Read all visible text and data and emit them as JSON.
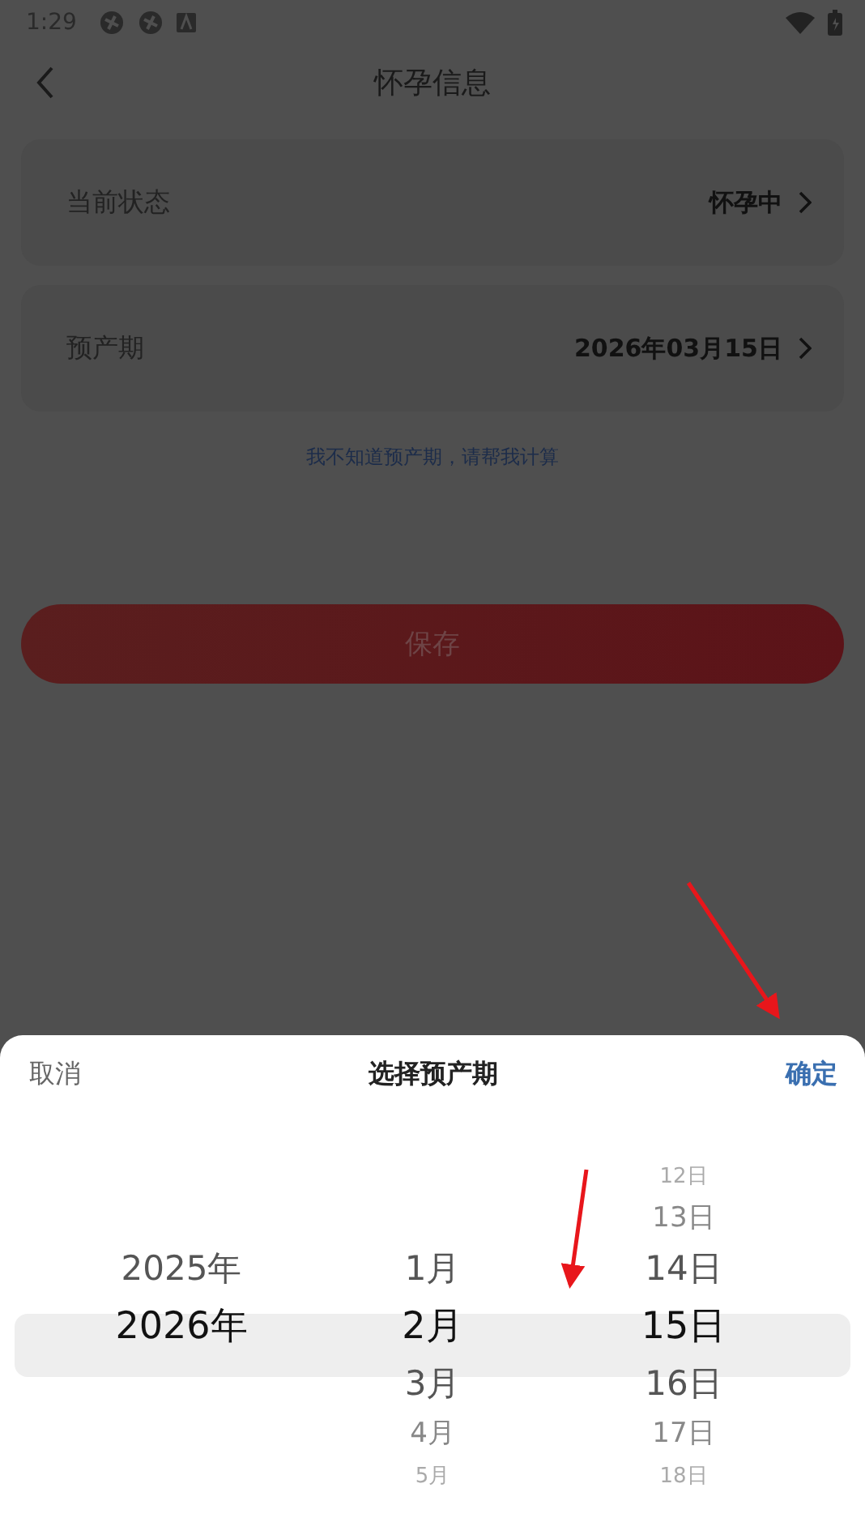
{
  "status_bar": {
    "time": "1:29"
  },
  "header": {
    "title": "怀孕信息"
  },
  "fields": [
    {
      "label": "当前状态",
      "value": "怀孕中"
    },
    {
      "label": "预产期",
      "value": "2026年03月15日"
    }
  ],
  "help_link": "我不知道预产期，请帮我计算",
  "save_button": "保存",
  "picker": {
    "cancel": "取消",
    "title": "选择预产期",
    "confirm": "确定",
    "columns": [
      {
        "items": [
          {
            "label": "2025年",
            "selected": false
          },
          {
            "label": "2026年",
            "selected": true
          }
        ]
      },
      {
        "items": [
          {
            "label": "1月",
            "selected": false
          },
          {
            "label": "2月",
            "selected": true
          },
          {
            "label": "3月",
            "selected": false
          },
          {
            "label": "4月",
            "selected": false
          },
          {
            "label": "5月",
            "selected": false
          }
        ]
      },
      {
        "items": [
          {
            "label": "12日",
            "selected": false
          },
          {
            "label": "13日",
            "selected": false
          },
          {
            "label": "14日",
            "selected": false
          },
          {
            "label": "15日",
            "selected": true
          },
          {
            "label": "16日",
            "selected": false
          },
          {
            "label": "17日",
            "selected": false
          },
          {
            "label": "18日",
            "selected": false
          }
        ]
      }
    ]
  }
}
